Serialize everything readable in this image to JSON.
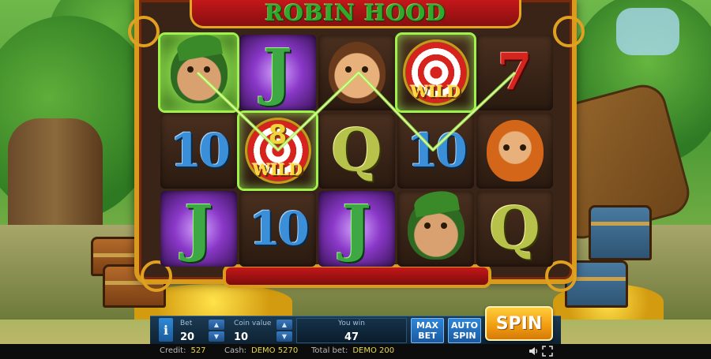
{
  "game": {
    "title": "ROBIN HOOD"
  },
  "reels": [
    [
      {
        "symbol": "robin-hood",
        "type": "face-robin",
        "win": true,
        "fx": "sparkle"
      },
      {
        "symbol": "10",
        "type": "ten"
      },
      {
        "symbol": "J",
        "type": "j",
        "fx": "purple"
      }
    ],
    [
      {
        "symbol": "J",
        "type": "j",
        "fx": "purple"
      },
      {
        "symbol": "wild",
        "type": "wild",
        "multiplier": "8",
        "wild_label": "WILD",
        "win": true
      },
      {
        "symbol": "10",
        "type": "ten"
      }
    ],
    [
      {
        "symbol": "friar",
        "type": "face-man"
      },
      {
        "symbol": "Q",
        "type": "q"
      },
      {
        "symbol": "J",
        "type": "j",
        "fx": "purple"
      }
    ],
    [
      {
        "symbol": "wild",
        "type": "wild",
        "wild_label": "WILD",
        "win": true
      },
      {
        "symbol": "10",
        "type": "ten"
      },
      {
        "symbol": "robin-hood",
        "type": "face-robin"
      }
    ],
    [
      {
        "symbol": "7",
        "type": "seven"
      },
      {
        "symbol": "dwarf",
        "type": "face-dwarf"
      },
      {
        "symbol": "Q",
        "type": "q"
      }
    ]
  ],
  "controls": {
    "info_label": "i",
    "bet": {
      "label": "Bet",
      "value": "20"
    },
    "coin_value": {
      "label": "Coin value",
      "value": "10"
    },
    "you_win": {
      "label": "You win",
      "value": "47"
    },
    "max_bet_label": "MAX\nBET",
    "auto_spin_label": "AUTO\nSPIN",
    "spin_label": "SPIN",
    "stepper_up": "▲",
    "stepper_down": "▼"
  },
  "status": {
    "credit": {
      "label": "Credit:",
      "value": "527"
    },
    "cash": {
      "label": "Cash:",
      "value": "DEMO 5270"
    },
    "total_bet": {
      "label": "Total bet:",
      "value": "DEMO 200"
    },
    "sound_icon": "speaker-icon",
    "fullscreen_icon": "fullscreen-icon"
  },
  "colors": {
    "accent_gold": "#d99a1e",
    "win_line": "#9ef24a",
    "spin_button": "#f09a10",
    "status_value": "#e8d84a"
  }
}
